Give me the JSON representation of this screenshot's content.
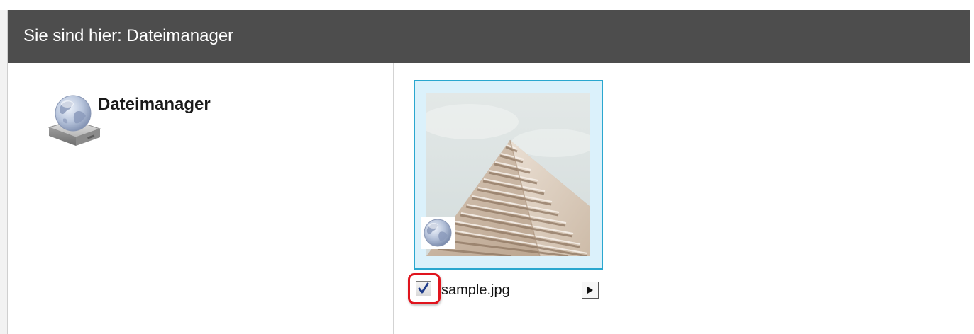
{
  "header": {
    "breadcrumb": "Sie sind hier: Dateimanager"
  },
  "tree": {
    "root_label": "Dateimanager",
    "root_icon": "network-drive-icon"
  },
  "files": [
    {
      "name": "sample.jpg",
      "selected": true,
      "thumbnail": "building-photo",
      "overlay_icon": "globe-icon"
    }
  ],
  "colors": {
    "header_bg": "#4d4d4d",
    "header_text": "#ffffff",
    "tile_bg": "#dbf1fb",
    "tile_border": "#2aa7cf",
    "highlight": "#e0141d"
  }
}
